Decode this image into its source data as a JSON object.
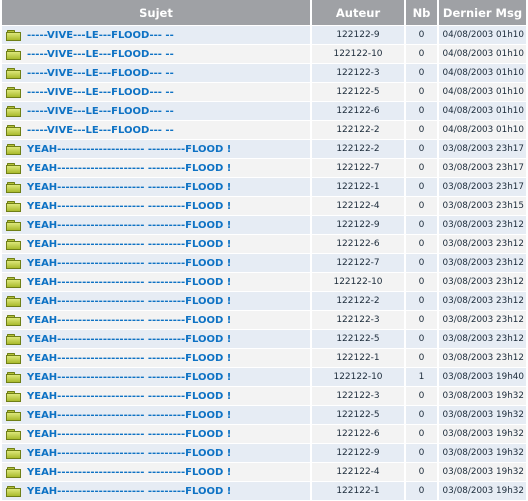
{
  "columns": {
    "subject": "Sujet",
    "author": "Auteur",
    "count": "Nb",
    "last_message": "Dernier Msg"
  },
  "icons": {
    "topic": "folder-icon"
  },
  "colors": {
    "header_bg": "#9fa1a5",
    "row_odd": "#e6ecf4",
    "row_even": "#f3f3f3",
    "link": "#0e72c4"
  },
  "rows": [
    {
      "subject": "-----VIVE---LE---FLOOD--- --",
      "author": "122122-9",
      "count": "0",
      "last_message": "04/08/2003 01h10"
    },
    {
      "subject": "-----VIVE---LE---FLOOD--- --",
      "author": "122122-10",
      "count": "0",
      "last_message": "04/08/2003 01h10"
    },
    {
      "subject": "-----VIVE---LE---FLOOD--- --",
      "author": "122122-3",
      "count": "0",
      "last_message": "04/08/2003 01h10"
    },
    {
      "subject": "-----VIVE---LE---FLOOD--- --",
      "author": "122122-5",
      "count": "0",
      "last_message": "04/08/2003 01h10"
    },
    {
      "subject": "-----VIVE---LE---FLOOD--- --",
      "author": "122122-6",
      "count": "0",
      "last_message": "04/08/2003 01h10"
    },
    {
      "subject": "-----VIVE---LE---FLOOD--- --",
      "author": "122122-2",
      "count": "0",
      "last_message": "04/08/2003 01h10"
    },
    {
      "subject": "YEAH--------------------- ---------FLOOD !",
      "author": "122122-2",
      "count": "0",
      "last_message": "03/08/2003 23h17"
    },
    {
      "subject": "YEAH--------------------- ---------FLOOD !",
      "author": "122122-7",
      "count": "0",
      "last_message": "03/08/2003 23h17"
    },
    {
      "subject": "YEAH--------------------- ---------FLOOD !",
      "author": "122122-1",
      "count": "0",
      "last_message": "03/08/2003 23h17"
    },
    {
      "subject": "YEAH--------------------- ---------FLOOD !",
      "author": "122122-4",
      "count": "0",
      "last_message": "03/08/2003 23h15"
    },
    {
      "subject": "YEAH--------------------- ---------FLOOD !",
      "author": "122122-9",
      "count": "0",
      "last_message": "03/08/2003 23h12"
    },
    {
      "subject": "YEAH--------------------- ---------FLOOD !",
      "author": "122122-6",
      "count": "0",
      "last_message": "03/08/2003 23h12"
    },
    {
      "subject": "YEAH--------------------- ---------FLOOD !",
      "author": "122122-7",
      "count": "0",
      "last_message": "03/08/2003 23h12"
    },
    {
      "subject": "YEAH--------------------- ---------FLOOD !",
      "author": "122122-10",
      "count": "0",
      "last_message": "03/08/2003 23h12"
    },
    {
      "subject": "YEAH--------------------- ---------FLOOD !",
      "author": "122122-2",
      "count": "0",
      "last_message": "03/08/2003 23h12"
    },
    {
      "subject": "YEAH--------------------- ---------FLOOD !",
      "author": "122122-3",
      "count": "0",
      "last_message": "03/08/2003 23h12"
    },
    {
      "subject": "YEAH--------------------- ---------FLOOD !",
      "author": "122122-5",
      "count": "0",
      "last_message": "03/08/2003 23h12"
    },
    {
      "subject": "YEAH--------------------- ---------FLOOD !",
      "author": "122122-1",
      "count": "0",
      "last_message": "03/08/2003 23h12"
    },
    {
      "subject": "YEAH--------------------- ---------FLOOD !",
      "author": "122122-10",
      "count": "1",
      "last_message": "03/08/2003 19h40"
    },
    {
      "subject": "YEAH--------------------- ---------FLOOD !",
      "author": "122122-3",
      "count": "0",
      "last_message": "03/08/2003 19h32"
    },
    {
      "subject": "YEAH--------------------- ---------FLOOD !",
      "author": "122122-5",
      "count": "0",
      "last_message": "03/08/2003 19h32"
    },
    {
      "subject": "YEAH--------------------- ---------FLOOD !",
      "author": "122122-6",
      "count": "0",
      "last_message": "03/08/2003 19h32"
    },
    {
      "subject": "YEAH--------------------- ---------FLOOD !",
      "author": "122122-9",
      "count": "0",
      "last_message": "03/08/2003 19h32"
    },
    {
      "subject": "YEAH--------------------- ---------FLOOD !",
      "author": "122122-4",
      "count": "0",
      "last_message": "03/08/2003 19h32"
    },
    {
      "subject": "YEAH--------------------- ---------FLOOD !",
      "author": "122122-1",
      "count": "0",
      "last_message": "03/08/2003 19h32"
    }
  ]
}
